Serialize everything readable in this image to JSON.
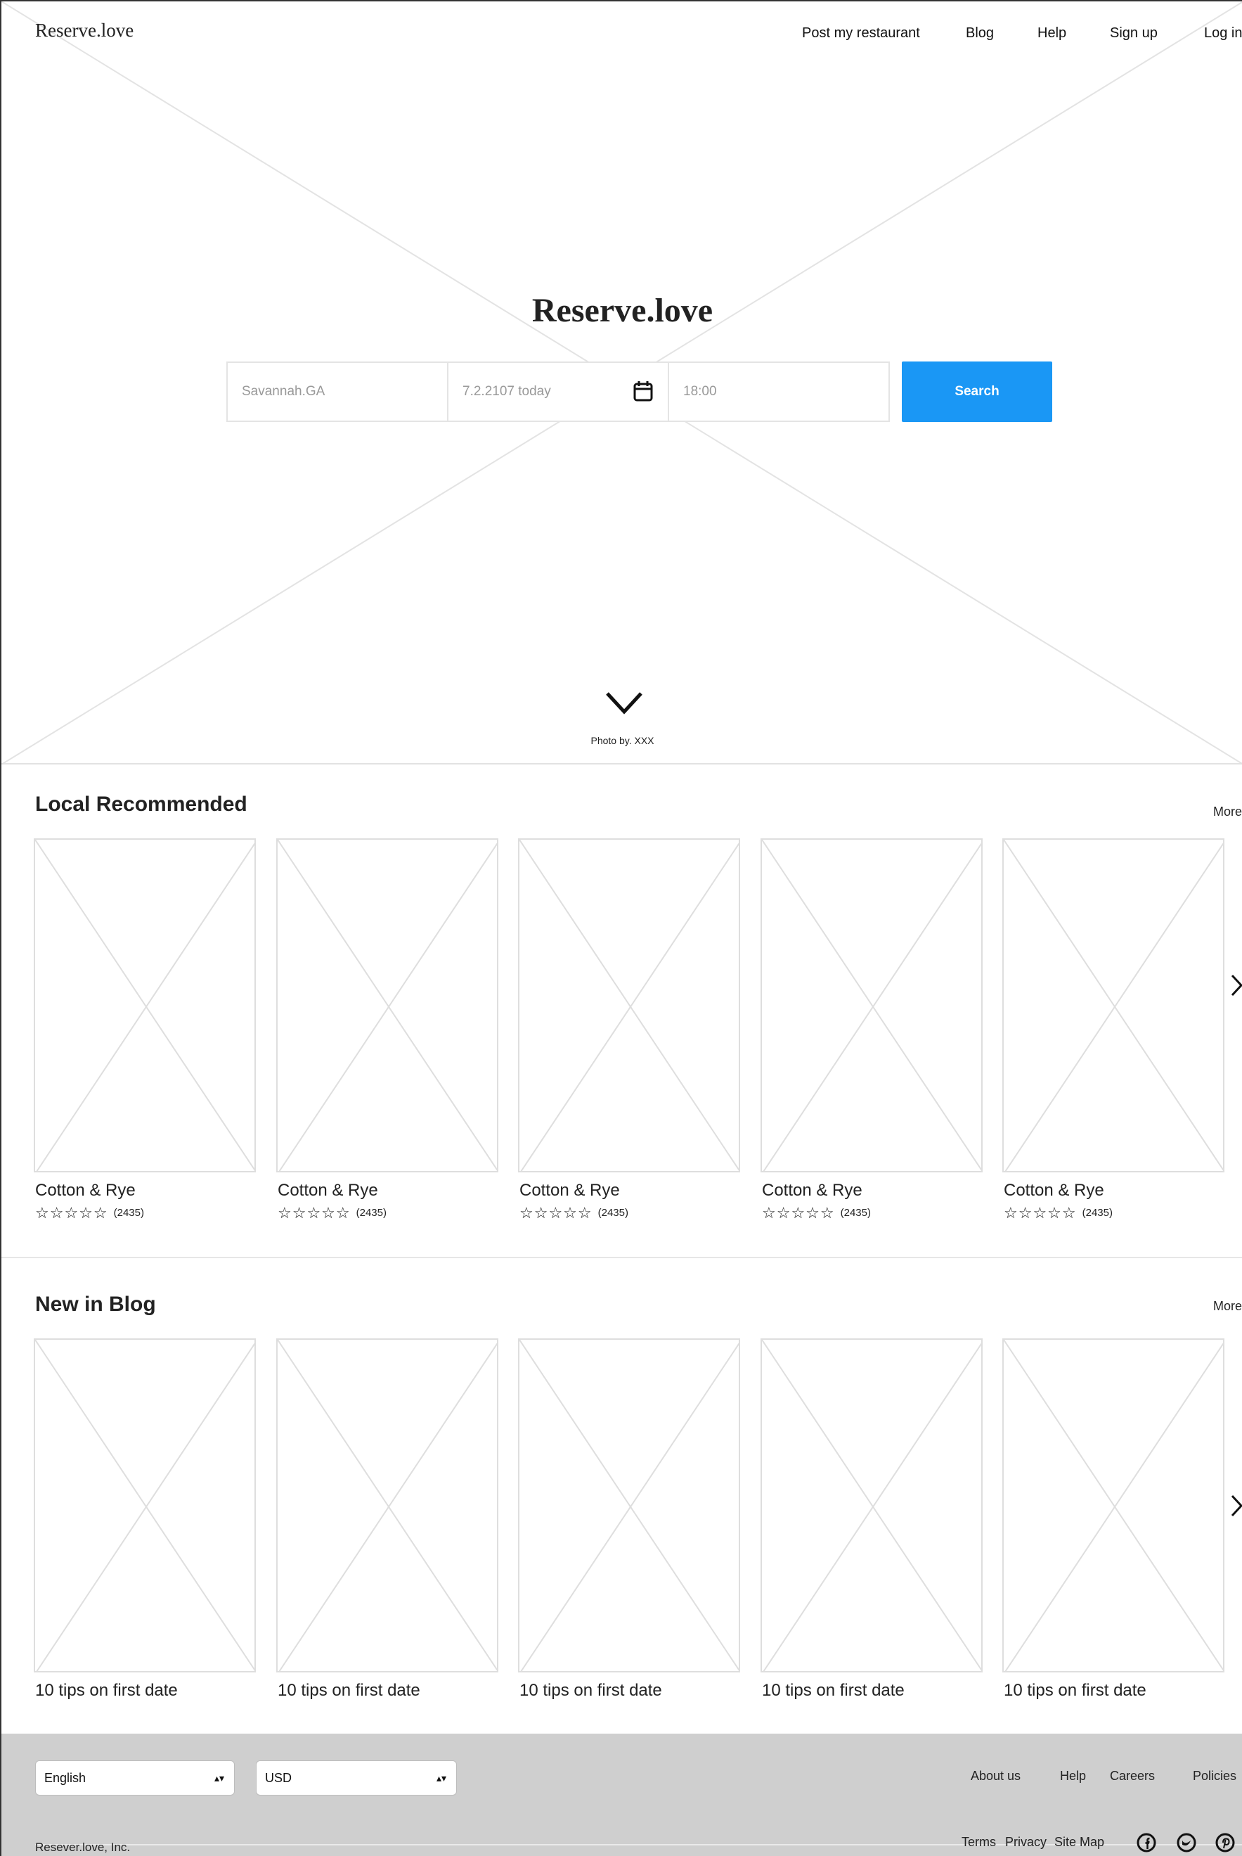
{
  "header": {
    "brand": "Reserve.love",
    "nav": [
      "Post my restaurant",
      "Blog",
      "Help",
      "Sign up",
      "Log in"
    ]
  },
  "hero": {
    "title": "Reserve.love",
    "location_value": "Savannah.GA",
    "date_value": "7.2.2107 today",
    "time_value": "18:00",
    "search_label": "Search",
    "photo_credit": "Photo by. XXX",
    "icons": [
      "calendar-icon",
      "chevron-down-icon"
    ]
  },
  "local": {
    "title": "Local Recommended",
    "more": "More",
    "items": [
      {
        "name": "Cotton & Rye",
        "stars": "☆☆☆☆☆",
        "count": "(2435)"
      },
      {
        "name": "Cotton & Rye",
        "stars": "☆☆☆☆☆",
        "count": "(2435)"
      },
      {
        "name": "Cotton & Rye",
        "stars": "☆☆☆☆☆",
        "count": "(2435)"
      },
      {
        "name": "Cotton & Rye",
        "stars": "☆☆☆☆☆",
        "count": "(2435)"
      },
      {
        "name": "Cotton & Rye",
        "stars": "☆☆☆☆☆",
        "count": "(2435)"
      }
    ]
  },
  "blog": {
    "title": "New in Blog",
    "more": "More",
    "items": [
      {
        "title": "10 tips on first date"
      },
      {
        "title": "10 tips on first date"
      },
      {
        "title": "10 tips on first date"
      },
      {
        "title": "10 tips on first date"
      },
      {
        "title": "10 tips on first date"
      }
    ]
  },
  "footer": {
    "language": "English",
    "currency": "USD",
    "links": [
      "About us",
      "Help",
      "Careers",
      "Policies"
    ],
    "bottom_links": [
      "Terms",
      "Privacy",
      "Site Map"
    ],
    "copyright": "Resever.love, Inc.",
    "social_icons": [
      "facebook-icon",
      "twitter-icon",
      "pinterest-icon"
    ]
  },
  "colors": {
    "accent": "#1a97f5",
    "footer_bg": "#cfcfcf",
    "placeholder_stroke": "#dedede"
  }
}
